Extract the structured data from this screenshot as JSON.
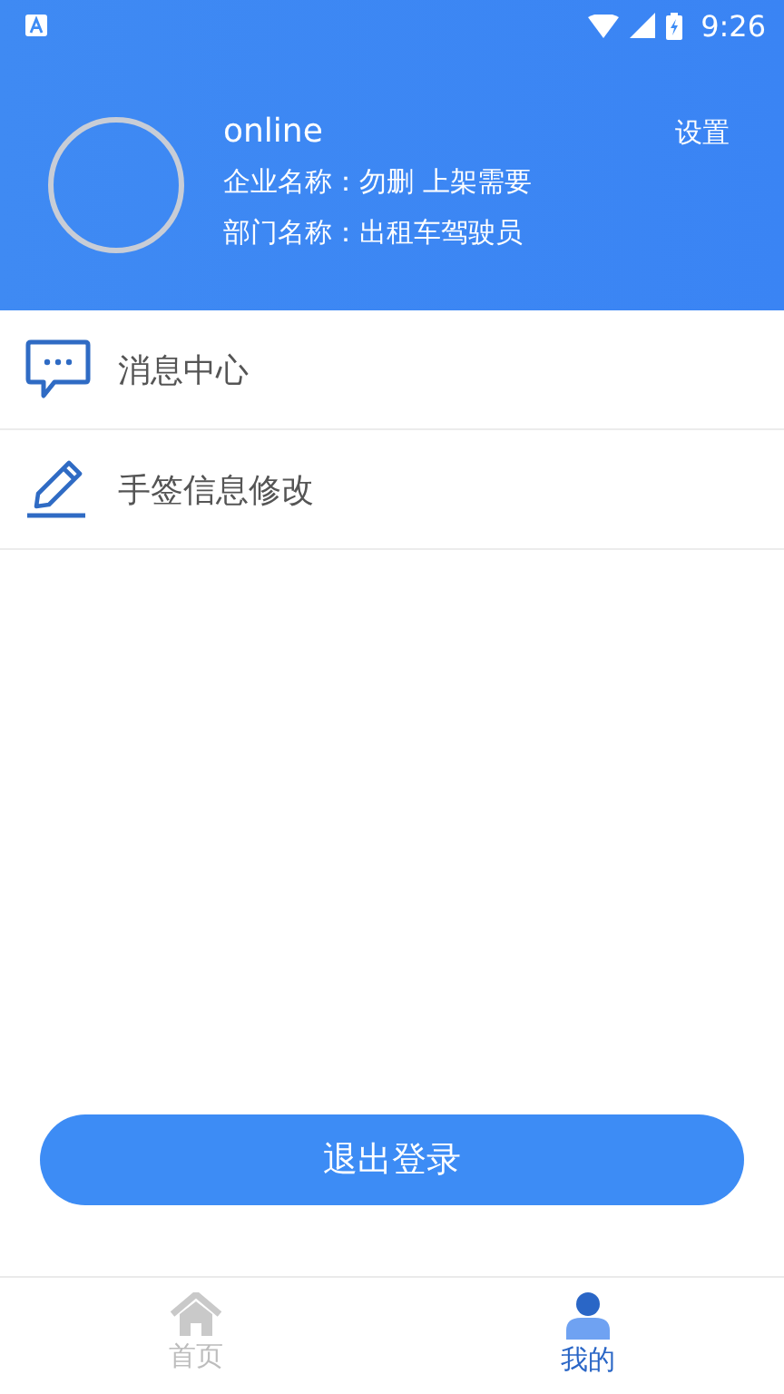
{
  "status_bar": {
    "time": "9:26"
  },
  "profile": {
    "name": "online",
    "company": "企业名称：勿删 上架需要",
    "department": "部门名称：出租车驾驶员",
    "settings": "设置"
  },
  "menu": [
    {
      "kind": "message",
      "label": "消息中心"
    },
    {
      "kind": "edit",
      "label": "手签信息修改"
    }
  ],
  "logout": "退出登录",
  "nav": [
    {
      "kind": "home",
      "label": "首页",
      "selected": false
    },
    {
      "kind": "profile",
      "label": "我的",
      "selected": true
    }
  ]
}
